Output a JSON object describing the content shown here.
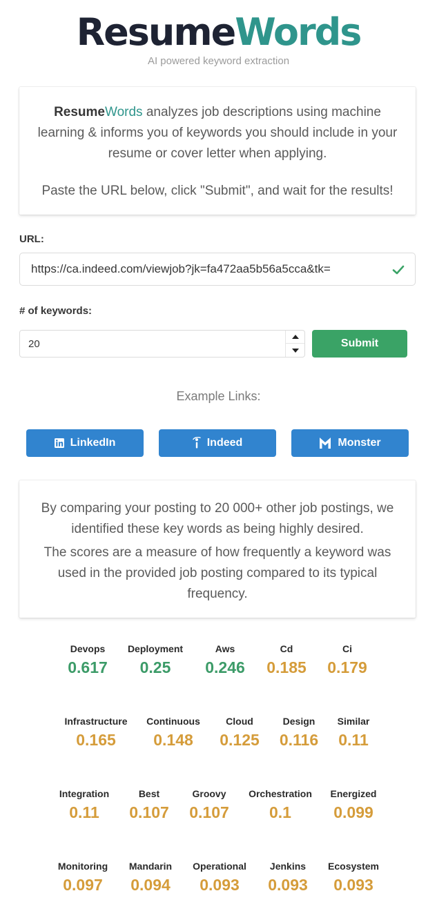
{
  "header": {
    "logo_part1": "Resume",
    "logo_part2": "Words",
    "tagline": "AI powered keyword extraction"
  },
  "intro": {
    "brand_part1": "Resume",
    "brand_part2": "Words",
    "text1": " analyzes job descriptions using machine learning & informs you of keywords you should include in your resume or cover letter when applying.",
    "text2": "Paste the URL below, click \"Submit\", and wait for the results!"
  },
  "form": {
    "url_label": "URL:",
    "url_value": "https://ca.indeed.com/viewjob?jk=fa472aa5b56a5cca&tk=",
    "keywords_label": "# of keywords:",
    "keywords_value": "20",
    "submit_label": "Submit"
  },
  "examples": {
    "title": "Example Links:",
    "buttons": [
      {
        "label": "LinkedIn",
        "icon": "linkedin-icon"
      },
      {
        "label": "Indeed",
        "icon": "indeed-icon"
      },
      {
        "label": "Monster",
        "icon": "monster-icon"
      }
    ]
  },
  "explanation": {
    "p1": "By comparing your posting to 20 000+ other job postings, we identified these key words as being highly desired.",
    "p2": "The scores are a measure of how frequently a keyword was used in the provided job posting compared to its typical frequency."
  },
  "colors": {
    "high_score": "#3c9b68",
    "mid_score": "#d59c3a"
  },
  "keywords": [
    {
      "name": "Devops",
      "score": "0.617",
      "level": "high"
    },
    {
      "name": "Deployment",
      "score": "0.25",
      "level": "high"
    },
    {
      "name": "Aws",
      "score": "0.246",
      "level": "high"
    },
    {
      "name": "Cd",
      "score": "0.185",
      "level": "mid"
    },
    {
      "name": "Ci",
      "score": "0.179",
      "level": "mid"
    },
    {
      "name": "Infrastructure",
      "score": "0.165",
      "level": "mid"
    },
    {
      "name": "Continuous",
      "score": "0.148",
      "level": "mid"
    },
    {
      "name": "Cloud",
      "score": "0.125",
      "level": "mid"
    },
    {
      "name": "Design",
      "score": "0.116",
      "level": "mid"
    },
    {
      "name": "Similar",
      "score": "0.11",
      "level": "mid"
    },
    {
      "name": "Integration",
      "score": "0.11",
      "level": "mid"
    },
    {
      "name": "Best",
      "score": "0.107",
      "level": "mid"
    },
    {
      "name": "Groovy",
      "score": "0.107",
      "level": "mid"
    },
    {
      "name": "Orchestration",
      "score": "0.1",
      "level": "mid"
    },
    {
      "name": "Energized",
      "score": "0.099",
      "level": "mid"
    },
    {
      "name": "Monitoring",
      "score": "0.097",
      "level": "mid"
    },
    {
      "name": "Mandarin",
      "score": "0.094",
      "level": "mid"
    },
    {
      "name": "Operational",
      "score": "0.093",
      "level": "mid"
    },
    {
      "name": "Jenkins",
      "score": "0.093",
      "level": "mid"
    },
    {
      "name": "Ecosystem",
      "score": "0.093",
      "level": "mid"
    }
  ]
}
